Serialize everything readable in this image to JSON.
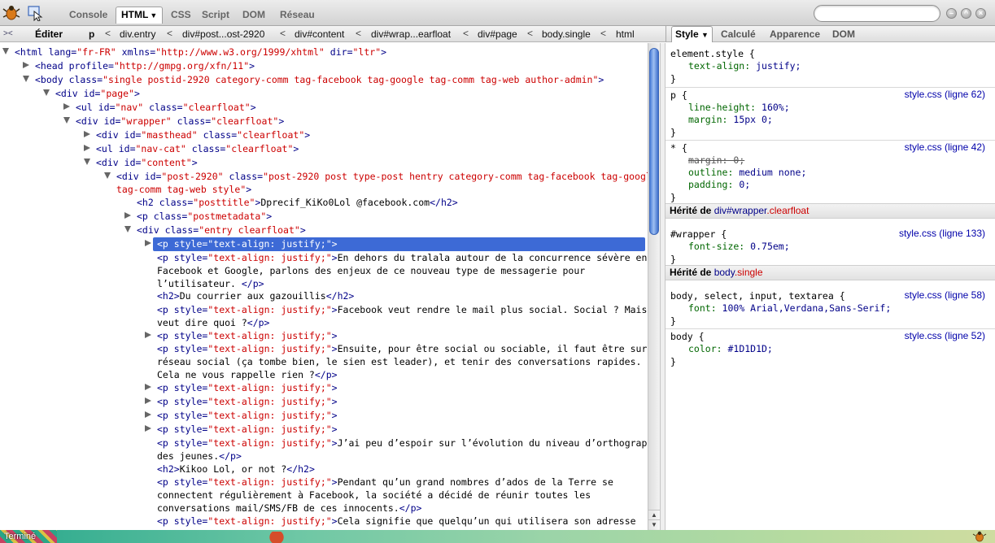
{
  "toolbar": {
    "tabs": [
      "Console",
      "HTML",
      "CSS",
      "Script",
      "DOM",
      "Réseau"
    ],
    "search_placeholder": ""
  },
  "breadcrumb": {
    "edit_label": "Éditer",
    "items": [
      "p",
      "div.entry",
      "div#post...ost-2920",
      "div#content",
      "div#wrap...earfloat",
      "div#page",
      "body.single",
      "html"
    ],
    "separator": "<"
  },
  "sidebar": {
    "tabs": [
      "Style",
      "Calculé",
      "Apparence",
      "DOM"
    ],
    "rules": [
      {
        "selector": "element.style {",
        "source": "",
        "props": [
          {
            "name": "text-align",
            "value": "justify;",
            "overridden": false
          }
        ]
      },
      {
        "selector": "p {",
        "source": "style.css (ligne 62)",
        "props": [
          {
            "name": "line-height",
            "value": "160%;",
            "overridden": false
          },
          {
            "name": "margin",
            "value": "15px 0;",
            "overridden": false
          }
        ]
      },
      {
        "selector": "* {",
        "source": "style.css (ligne 42)",
        "props": [
          {
            "name": "margin",
            "value": "0;",
            "overridden": true
          },
          {
            "name": "outline",
            "value": "medium none;",
            "overridden": false
          },
          {
            "name": "padding",
            "value": "0;",
            "overridden": false
          }
        ]
      }
    ],
    "inherited_1": {
      "label": "Hérité de",
      "element": "div#wrapper",
      "cls": ".clearfloat"
    },
    "rules_1": [
      {
        "selector": "#wrapper {",
        "source": "style.css (ligne 133)",
        "props": [
          {
            "name": "font-size",
            "value": "0.75em;",
            "overridden": false
          }
        ]
      }
    ],
    "inherited_2": {
      "label": "Hérité de",
      "element": "body",
      "cls": ".single"
    },
    "rules_2": [
      {
        "selector": "body, select, input, textarea {",
        "source": "style.css (ligne 58)",
        "props": [
          {
            "name": "font",
            "value": "100% Arial,Verdana,Sans-Serif;",
            "overridden": false
          }
        ]
      },
      {
        "selector": "body {",
        "source": "style.css (ligne 52)",
        "props": [
          {
            "name": "color",
            "value": "#1D1D1D;",
            "overridden": false
          }
        ]
      }
    ],
    "close_brace": "}"
  },
  "dom_tree": [
    {
      "indent": 6,
      "twisty": "open",
      "html": "<span class='tg'>&lt;html</span> <span class='an'>lang=</span><span class='av'>\"fr-FR\"</span> <span class='an'>xmlns=</span><span class='av'>\"http://www.w3.org/1999/xhtml\"</span> <span class='an'>dir=</span><span class='av'>\"ltr\"</span><span class='tg'>&gt;</span>"
    },
    {
      "indent": 31,
      "twisty": "closed",
      "html": "<span class='tg'>&lt;head</span> <span class='an'>profile=</span><span class='av'>\"http://gmpg.org/xfn/11\"</span><span class='tg'>&gt;</span>"
    },
    {
      "indent": 31,
      "twisty": "open",
      "html": "<span class='tg'>&lt;body</span> <span class='an'>class=</span><span class='av'>\"single postid-2920 category-comm tag-facebook tag-google tag-comm tag-web author-admin\"</span><span class='tg'>&gt;</span>"
    },
    {
      "indent": 56,
      "twisty": "open",
      "html": "<span class='tg'>&lt;div</span> <span class='an'>id=</span><span class='av'>\"page\"</span><span class='tg'>&gt;</span>"
    },
    {
      "indent": 81,
      "twisty": "closed",
      "html": "<span class='tg'>&lt;ul</span> <span class='an'>id=</span><span class='av'>\"nav\"</span> <span class='an'>class=</span><span class='av'>\"clearfloat\"</span><span class='tg'>&gt;</span>"
    },
    {
      "indent": 81,
      "twisty": "open",
      "html": "<span class='tg'>&lt;div</span> <span class='an'>id=</span><span class='av'>\"wrapper\"</span> <span class='an'>class=</span><span class='av'>\"clearfloat\"</span><span class='tg'>&gt;</span>"
    },
    {
      "indent": 106,
      "twisty": "closed",
      "html": "<span class='tg'>&lt;div</span> <span class='an'>id=</span><span class='av'>\"masthead\"</span> <span class='an'>class=</span><span class='av'>\"clearfloat\"</span><span class='tg'>&gt;</span>"
    },
    {
      "indent": 106,
      "twisty": "closed",
      "html": "<span class='tg'>&lt;ul</span> <span class='an'>id=</span><span class='av'>\"nav-cat\"</span> <span class='an'>class=</span><span class='av'>\"clearfloat\"</span><span class='tg'>&gt;</span>"
    },
    {
      "indent": 106,
      "twisty": "open",
      "html": "<span class='tg'>&lt;div</span> <span class='an'>id=</span><span class='av'>\"content\"</span><span class='tg'>&gt;</span>"
    },
    {
      "indent": 131,
      "twisty": "open",
      "html": "<span class='tg'>&lt;div</span> <span class='an'>id=</span><span class='av'>\"post-2920\"</span> <span class='an'>class=</span><span class='av'>\"post-2920 post type-post hentry category-comm tag-facebook tag-google</span>\n<span class='av'>tag-comm tag-web style\"</span><span class='tg'>&gt;</span>"
    },
    {
      "indent": 156,
      "twisty": "none",
      "html": "<span class='tg'>&lt;h2</span> <span class='an'>class=</span><span class='av'>\"posttitle\"</span><span class='tg'>&gt;</span><span class='tx'>Dprecif_KiKo0Lol @facebook.com</span><span class='tg'>&lt;/h2&gt;</span>"
    },
    {
      "indent": 156,
      "twisty": "closed",
      "html": "<span class='tg'>&lt;p</span> <span class='an'>class=</span><span class='av'>\"postmetadata\"</span><span class='tg'>&gt;</span>"
    },
    {
      "indent": 156,
      "twisty": "open",
      "html": "<span class='tg'>&lt;div</span> <span class='an'>class=</span><span class='av'>\"entry clearfloat\"</span><span class='tg'>&gt;</span>"
    },
    {
      "indent": 181,
      "twisty": "closed",
      "selected": true,
      "html": "&lt;p style=\"text-align: justify;\"&gt;"
    },
    {
      "indent": 181,
      "twisty": "none",
      "html": "<span class='tg'>&lt;p</span> <span class='an'>style=</span><span class='av'>\"text-align: justify;\"</span><span class='tg'>&gt;</span><span class='tx'>En dehors du tralala autour de la concurrence sévère entre</span>\n<span class='tx'>Facebook et Google, parlons des enjeux de ce nouveau type de messagerie pour</span>\n<span class='tx'>l’utilisateur.</span> <span class='tg'>&lt;/p&gt;</span>"
    },
    {
      "indent": 181,
      "twisty": "none",
      "html": "<span class='tg'>&lt;h2&gt;</span><span class='tx'>Du courrier aux gazouillis</span><span class='tg'>&lt;/h2&gt;</span>"
    },
    {
      "indent": 181,
      "twisty": "none",
      "html": "<span class='tg'>&lt;p</span> <span class='an'>style=</span><span class='av'>\"text-align: justify;\"</span><span class='tg'>&gt;</span><span class='tx'>Facebook veut rendre le mail plus social. Social ? Mais ça</span>\n<span class='tx'>veut dire quoi ?</span><span class='tg'>&lt;/p&gt;</span>"
    },
    {
      "indent": 181,
      "twisty": "closed",
      "html": "<span class='tg'>&lt;p</span> <span class='an'>style=</span><span class='av'>\"text-align: justify;\"</span><span class='tg'>&gt;</span>"
    },
    {
      "indent": 181,
      "twisty": "none",
      "html": "<span class='tg'>&lt;p</span> <span class='an'>style=</span><span class='av'>\"text-align: justify;\"</span><span class='tg'>&gt;</span><span class='tx'>Ensuite, pour être social ou sociable, il faut être sur un</span>\n<span class='tx'>réseau social (ça tombe bien, le sien est leader), et tenir des conversations rapides.</span>\n<span class='tx'>Cela ne vous rappelle rien ?</span><span class='tg'>&lt;/p&gt;</span>"
    },
    {
      "indent": 181,
      "twisty": "closed",
      "html": "<span class='tg'>&lt;p</span> <span class='an'>style=</span><span class='av'>\"text-align: justify;\"</span><span class='tg'>&gt;</span>"
    },
    {
      "indent": 181,
      "twisty": "closed",
      "html": "<span class='tg'>&lt;p</span> <span class='an'>style=</span><span class='av'>\"text-align: justify;\"</span><span class='tg'>&gt;</span>"
    },
    {
      "indent": 181,
      "twisty": "closed",
      "html": "<span class='tg'>&lt;p</span> <span class='an'>style=</span><span class='av'>\"text-align: justify;\"</span><span class='tg'>&gt;</span>"
    },
    {
      "indent": 181,
      "twisty": "closed",
      "html": "<span class='tg'>&lt;p</span> <span class='an'>style=</span><span class='av'>\"text-align: justify;\"</span><span class='tg'>&gt;</span>"
    },
    {
      "indent": 181,
      "twisty": "none",
      "html": "<span class='tg'>&lt;p</span> <span class='an'>style=</span><span class='av'>\"text-align: justify;\"</span><span class='tg'>&gt;</span><span class='tx'>J’ai peu d’espoir sur l’évolution du niveau d’orthographe</span>\n<span class='tx'>des jeunes.</span><span class='tg'>&lt;/p&gt;</span>"
    },
    {
      "indent": 181,
      "twisty": "none",
      "html": "<span class='tg'>&lt;h2&gt;</span><span class='tx'>Kikoo Lol, or not ?</span><span class='tg'>&lt;/h2&gt;</span>"
    },
    {
      "indent": 181,
      "twisty": "none",
      "html": "<span class='tg'>&lt;p</span> <span class='an'>style=</span><span class='av'>\"text-align: justify;\"</span><span class='tg'>&gt;</span><span class='tx'>Pendant qu’un grand nombres d’ados de la Terre se</span>\n<span class='tx'>connectent régulièrement à Facebook, la société a décidé de réunir toutes les</span>\n<span class='tx'>conversations mail/SMS/FB de ces innocents.</span><span class='tg'>&lt;/p&gt;</span>"
    },
    {
      "indent": 181,
      "twisty": "none",
      "html": "<span class='tg'>&lt;p</span> <span class='an'>style=</span><span class='av'>\"text-align: justify;\"</span><span class='tg'>&gt;</span><span class='tx'>Cela signifie que quelqu’un qui utilisera son adresse</span>"
    }
  ],
  "status": {
    "text": "Terminé"
  },
  "colors": {
    "selection": "#3d6ad6",
    "tag": "#000088",
    "attr_value": "#cc0000",
    "link": "#0000aa"
  }
}
